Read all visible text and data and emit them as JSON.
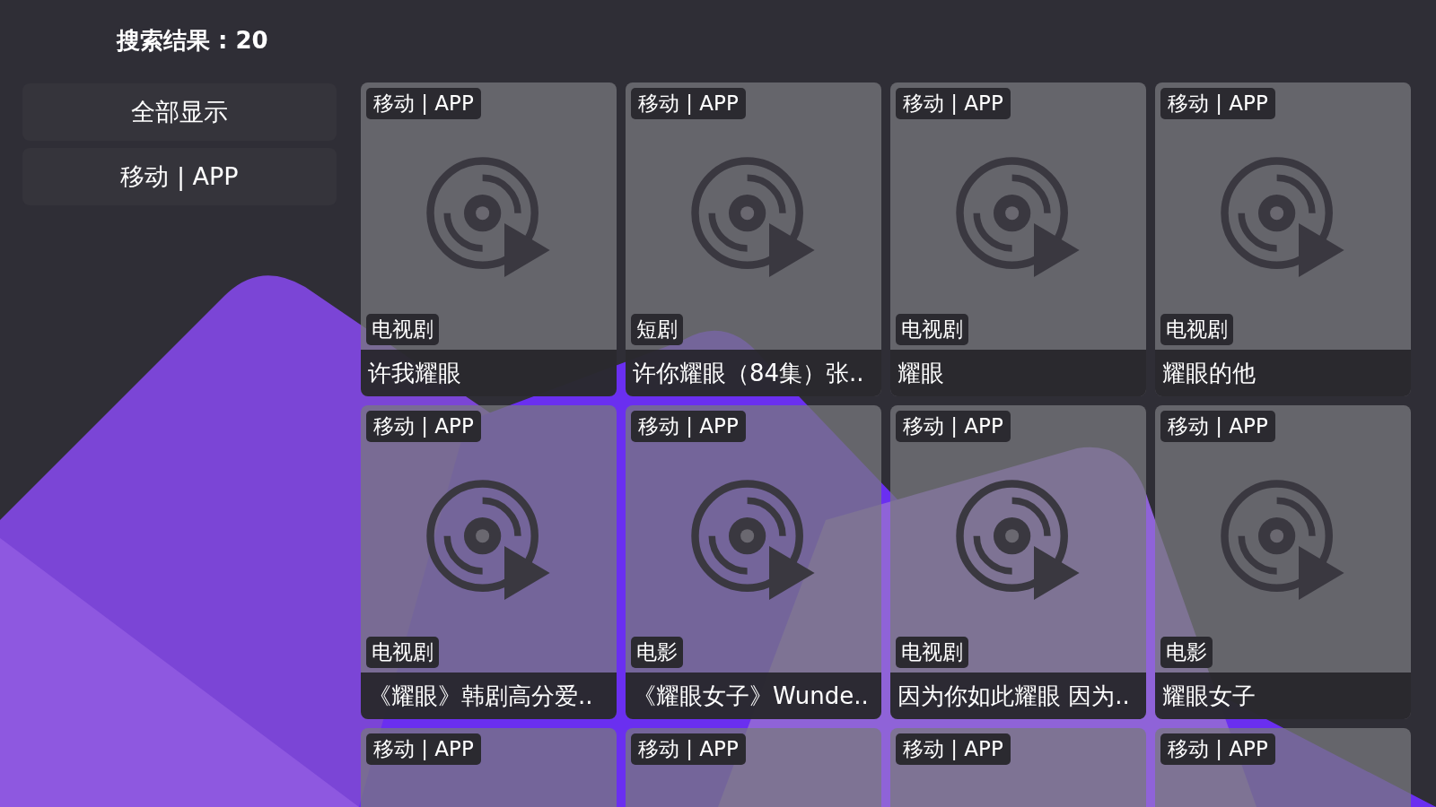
{
  "header": {
    "title": "搜索结果 : 20"
  },
  "filters": [
    {
      "label": "全部显示",
      "selected": false
    },
    {
      "label": "移动 | APP",
      "selected": false
    }
  ],
  "results": [
    {
      "source": "移动 | APP",
      "category": "电视剧",
      "title": "许我耀眼"
    },
    {
      "source": "移动 | APP",
      "category": "短剧",
      "title": "许你耀眼（84集）张.."
    },
    {
      "source": "移动 | APP",
      "category": "电视剧",
      "title": "耀眼"
    },
    {
      "source": "移动 | APP",
      "category": "电视剧",
      "title": "耀眼的他"
    },
    {
      "source": "移动 | APP",
      "category": "电视剧",
      "title": "《耀眼》韩剧高分爱.."
    },
    {
      "source": "移动 | APP",
      "category": "电影",
      "title": "《耀眼女子》Wunde.."
    },
    {
      "source": "移动 | APP",
      "category": "电视剧",
      "title": "因为你如此耀眼 因为.."
    },
    {
      "source": "移动 | APP",
      "category": "电影",
      "title": "耀眼女子"
    },
    {
      "source": "移动 | APP"
    },
    {
      "source": "移动 | APP"
    },
    {
      "source": "移动 | APP"
    },
    {
      "source": "移动 | APP"
    }
  ]
}
